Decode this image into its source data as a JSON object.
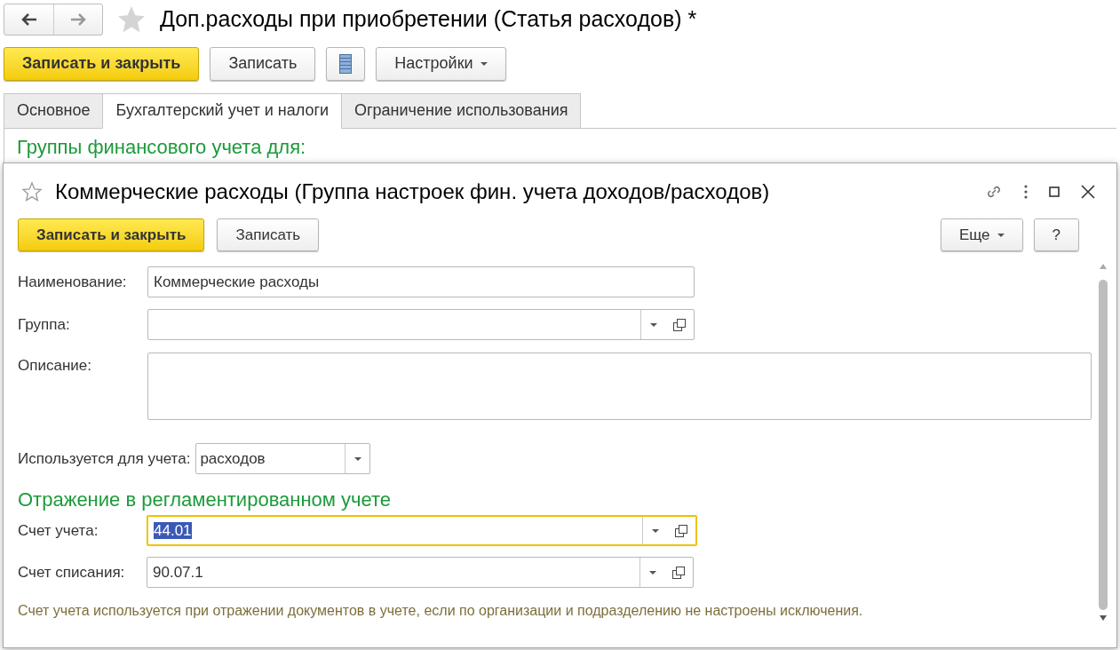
{
  "window": {
    "title": "Доп.расходы при приобретении (Статья расходов) *",
    "favorite": false
  },
  "toolbar": [
    {
      "kind": "primary",
      "label": "Записать и закрыть"
    },
    {
      "kind": "default",
      "label": "Записать"
    },
    {
      "kind": "icon"
    },
    {
      "kind": "menu",
      "label": "Настройки"
    }
  ],
  "tabs": [
    {
      "label": "Основное",
      "selected": false
    },
    {
      "label": "Бухгалтерский учет и налоги",
      "selected": true
    },
    {
      "label": "Ограничение использования",
      "selected": false
    }
  ],
  "section_heading": "Группы финансового учета для:",
  "dialog": {
    "title": "Коммерческие расходы (Группа настроек фин. учета доходов/расходов)",
    "favorite": false,
    "buttons": [
      {
        "kind": "primary",
        "label": "Записать и закрыть"
      },
      {
        "kind": "default",
        "label": "Записать"
      }
    ],
    "right_buttons": [
      {
        "kind": "menu",
        "label": "Еще"
      },
      {
        "kind": "default",
        "label": "?"
      }
    ],
    "fields": [
      {
        "kind": "text",
        "label": "Наименование:",
        "value": "Коммерческие расходы",
        "focused": false
      },
      {
        "kind": "reference",
        "label": "Группа:",
        "focused": false
      },
      {
        "kind": "textarea",
        "label": "Описание:",
        "focused": false
      }
    ],
    "usage": {
      "label": "Используется для учета:",
      "value": "расходов"
    },
    "accounting_heading": "Отражение в регламентированном учете",
    "accounts": [
      {
        "kind": "reference",
        "label": "Счет учета:",
        "value": "44.01",
        "focused": true,
        "text_selected": true
      },
      {
        "kind": "reference",
        "label": "Счет списания:",
        "value": "90.07.1",
        "focused": false,
        "text_selected": false
      }
    ],
    "note": "Счет учета используется при отражении документов в учете, если по организации и подразделению не настроены исключения."
  }
}
